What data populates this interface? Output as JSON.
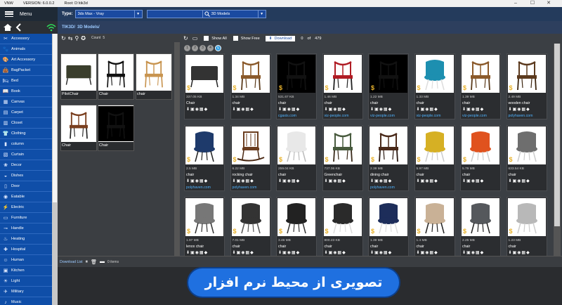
{
  "window": {
    "app": "VNW",
    "version": "VERSION: 6.0.0.2",
    "root": "Root: D:\\tik3d",
    "min": "–",
    "max": "☐",
    "close": "✕"
  },
  "menu": {
    "label": "Menu"
  },
  "type": {
    "label": "Type:",
    "value": "3ds Max - Vray",
    "search_value": "",
    "category": "3D Models"
  },
  "breadcrumb": [
    "TIK3D/",
    "3D Models/"
  ],
  "categories": [
    {
      "name": "Accessory",
      "icon": "✂"
    },
    {
      "name": "Animals",
      "icon": "🐾"
    },
    {
      "name": "Art Accessory",
      "icon": "🎨"
    },
    {
      "name": "BagPacket",
      "icon": "👜"
    },
    {
      "name": "Bed",
      "icon": "🛏"
    },
    {
      "name": "Book",
      "icon": "📖"
    },
    {
      "name": "Canvas",
      "icon": "▦"
    },
    {
      "name": "Carpet",
      "icon": "▤"
    },
    {
      "name": "Closet",
      "icon": "▥"
    },
    {
      "name": "Clothing",
      "icon": "👕"
    },
    {
      "name": "column",
      "icon": "▮"
    },
    {
      "name": "Curtain",
      "icon": "▧"
    },
    {
      "name": "Decor",
      "icon": "❀"
    },
    {
      "name": "Dishes",
      "icon": "◒"
    },
    {
      "name": "Door",
      "icon": "▯"
    },
    {
      "name": "Eatable",
      "icon": "◉"
    },
    {
      "name": "Electric",
      "icon": "⚡"
    },
    {
      "name": "Furniture",
      "icon": "▭"
    },
    {
      "name": "Handle",
      "icon": "⊸"
    },
    {
      "name": "Heating",
      "icon": "♨"
    },
    {
      "name": "Hospital",
      "icon": "✚"
    },
    {
      "name": "Human",
      "icon": "☺"
    },
    {
      "name": "Kitchen",
      "icon": "▣"
    },
    {
      "name": "Light",
      "icon": "☀"
    },
    {
      "name": "Military",
      "icon": "✈"
    },
    {
      "name": "Music",
      "icon": "♪"
    }
  ],
  "left_panel": {
    "count_label": "Count",
    "count": "5",
    "items": [
      {
        "name": "PilotChair",
        "style": "dark"
      },
      {
        "name": "Chair",
        "style": "wishbone"
      },
      {
        "name": "chair",
        "style": "rattan"
      },
      {
        "name": "Chair",
        "style": "leather"
      },
      {
        "name": "Chair",
        "style": "black"
      }
    ]
  },
  "main_toolbar": {
    "show_all": "Show All",
    "show_free": "Show Free",
    "download": "Download",
    "page": "0",
    "of": "of",
    "total": "479"
  },
  "pages": [
    "1",
    "2",
    "3",
    "4",
    "5"
  ],
  "active_page": 4,
  "models": [
    {
      "size": "337.05 KB",
      "name": "Chair",
      "source": "",
      "style": "bench"
    },
    {
      "size": "1.34 MB",
      "name": "chair",
      "source": "",
      "style": "wood"
    },
    {
      "size": "531.67 KB",
      "name": "chair",
      "source": "cgaxis.com",
      "style": "black"
    },
    {
      "size": "1.46 MB",
      "name": "chair",
      "source": "viz-people.com",
      "style": "red"
    },
    {
      "size": "1.22 MB",
      "name": "chair",
      "source": "viz-people.com",
      "style": "black"
    },
    {
      "size": "1.33 MB",
      "name": "chair",
      "source": "viz-people.com",
      "style": "teal"
    },
    {
      "size": "1.39 MB",
      "name": "chair",
      "source": "viz-people.com",
      "style": "wood"
    },
    {
      "size": "2.49 MB",
      "name": "wooden chair",
      "source": "polyhaven.com",
      "style": "tall"
    },
    {
      "size": "2.5 MB",
      "name": "chair",
      "source": "polyhaven.com",
      "style": "school"
    },
    {
      "size": "6.22 MB",
      "name": "rocking chair",
      "source": "polyhaven.com",
      "style": "rock"
    },
    {
      "size": "259.04 KB",
      "name": "chair",
      "source": "",
      "style": "white"
    },
    {
      "size": "737.06 KB",
      "name": "Greenchair",
      "source": "",
      "style": "green"
    },
    {
      "size": "2.38 MB",
      "name": "dining chair",
      "source": "polyhaven.com",
      "style": "brown"
    },
    {
      "size": "5.97 MB",
      "name": "chair",
      "source": "",
      "style": "yellow"
    },
    {
      "size": "5.79 MB",
      "name": "chair",
      "source": "",
      "style": "orange"
    },
    {
      "size": "633.54 KB",
      "name": "chair",
      "source": "",
      "style": "grey"
    },
    {
      "size": "1.97 MB",
      "name": "lenox chair",
      "source": "",
      "style": "lenox"
    },
    {
      "size": "7.01 MB",
      "name": "chair",
      "source": "",
      "style": "lounge"
    },
    {
      "size": "3.46 MB",
      "name": "chair",
      "source": "",
      "style": "swivel"
    },
    {
      "size": "800.23 KB",
      "name": "chair",
      "source": "",
      "style": "throw"
    },
    {
      "size": "1.39 MB",
      "name": "chair",
      "source": "",
      "style": "navy"
    },
    {
      "size": "1.4 MB",
      "name": "chair",
      "source": "",
      "style": "beige"
    },
    {
      "size": "2.25 MB",
      "name": "chair",
      "source": "",
      "style": "darkgrey"
    },
    {
      "size": "1.23 MB",
      "name": "chair",
      "source": "",
      "style": "lightgrey"
    }
  ],
  "card_actions": "⬇▣◉▦◆",
  "download_list": {
    "label": "Download List",
    "count": "0 items"
  },
  "banner": {
    "text": "تصویری از محیط نرم افزار"
  },
  "colors": {
    "sidebar": "#0f4ea8",
    "accent": "#2c9be0",
    "link": "#4fb3ff",
    "dollar": "#e8b22c"
  }
}
